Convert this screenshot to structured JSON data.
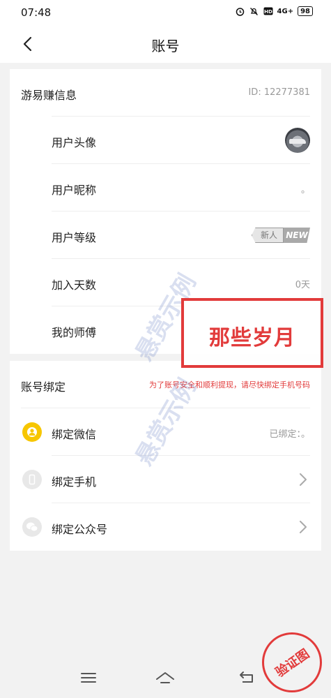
{
  "status_bar": {
    "time": "07:48",
    "network": "4G+",
    "battery": "98"
  },
  "header": {
    "title": "账号"
  },
  "info_section": {
    "title": "游易赚信息",
    "id_text": "ID: 12277381",
    "rows": [
      {
        "label": "用户头像",
        "value": ""
      },
      {
        "label": "用户昵称",
        "value": "。"
      },
      {
        "label": "用户等级",
        "badge_cn": "新人",
        "badge_en": "NEW"
      },
      {
        "label": "加入天数",
        "value": "0天"
      },
      {
        "label": "我的师傅",
        "value": ""
      }
    ]
  },
  "binding_section": {
    "title": "账号绑定",
    "hint": "为了账号安全和顺利提现，请尽快绑定手机号码",
    "rows": [
      {
        "label": "绑定微信",
        "value": "已绑定：。",
        "icon": "user-icon"
      },
      {
        "label": "绑定手机",
        "icon": "phone-icon"
      },
      {
        "label": "绑定公众号",
        "icon": "wechat-icon"
      }
    ]
  },
  "overlay": {
    "text": "那些岁月",
    "watermark": "悬赏示例",
    "stamp": "验证图"
  },
  "colors": {
    "accent_red": "#e23b3b",
    "wechat_yellow": "#f7c600",
    "background": "#f2f2f2"
  }
}
